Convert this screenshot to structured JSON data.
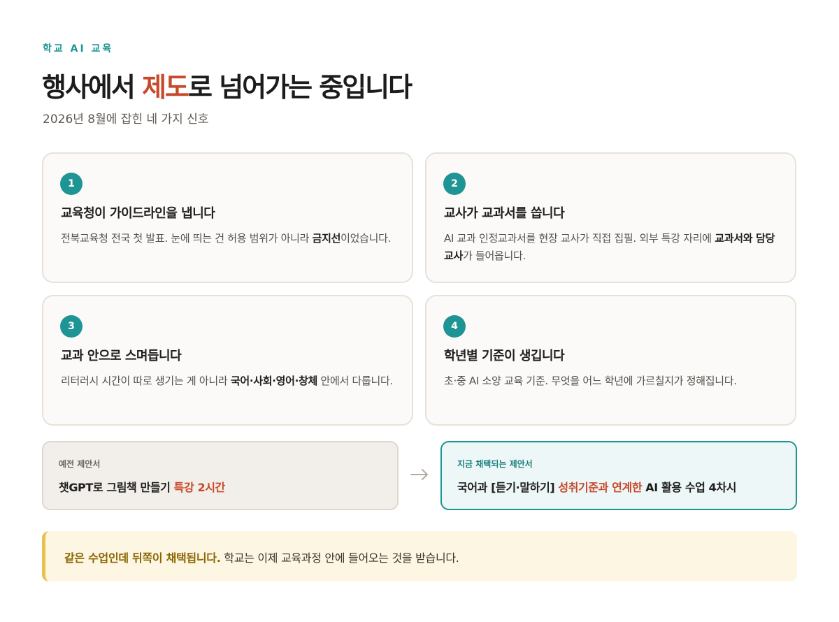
{
  "header": {
    "eyebrow": "학교 AI 교육",
    "title_before": "행사에서 ",
    "title_accent": "제도",
    "title_after": "로 넘어가는 중입니다",
    "subtitle": "2026년 8월에 잡힌 네 가지 신호"
  },
  "cards": [
    {
      "num": "1",
      "title": "교육청이 가이드라인을 냅니다",
      "body_before": "전북교육청 전국 첫 발표. 눈에 띄는 건 허용 범위가 아니라 ",
      "body_bold": "금지선",
      "body_after": "이었습니다."
    },
    {
      "num": "2",
      "title": "교사가 교과서를 씁니다",
      "body_before": "AI 교과 인정교과서를 현장 교사가 직접 집필. 외부 특강 자리에 ",
      "body_bold": "교과서와 담당 교사",
      "body_after": "가 들어옵니다."
    },
    {
      "num": "3",
      "title": "교과 안으로 스며듭니다",
      "body_before": "리터러시 시간이 따로 생기는 게 아니라 ",
      "body_bold": "국어·사회·영어·창체",
      "body_after": " 안에서 다룹니다."
    },
    {
      "num": "4",
      "title": "학년별 기준이 생깁니다",
      "body_before": "초·중 AI 소양 교육 기준. 무엇을 어느 학년에 가르칠지가 정해집니다.",
      "body_bold": "",
      "body_after": ""
    }
  ],
  "proposals": {
    "old": {
      "label": "예전 제안서",
      "text_before": "챗GPT로 그림책 만들기 ",
      "text_highlight": "특강 2시간"
    },
    "new": {
      "label": "지금 채택되는 제안서",
      "text_before": "국어과 [듣기·말하기] ",
      "text_highlight": "성취기준과 연계한",
      "text_after": " AI 활용 수업 4차시"
    },
    "arrow_icon": "arrow-right-icon"
  },
  "callout": {
    "strong": "같은 수업인데 뒤쪽이 채택됩니다.",
    "text": " 학교는 이제 교육과정 안에 들어오는 것을 받습니다."
  },
  "colors": {
    "accent_teal": "#1f9494",
    "accent_red": "#c8492a",
    "callout_gold": "#e9c24e"
  }
}
